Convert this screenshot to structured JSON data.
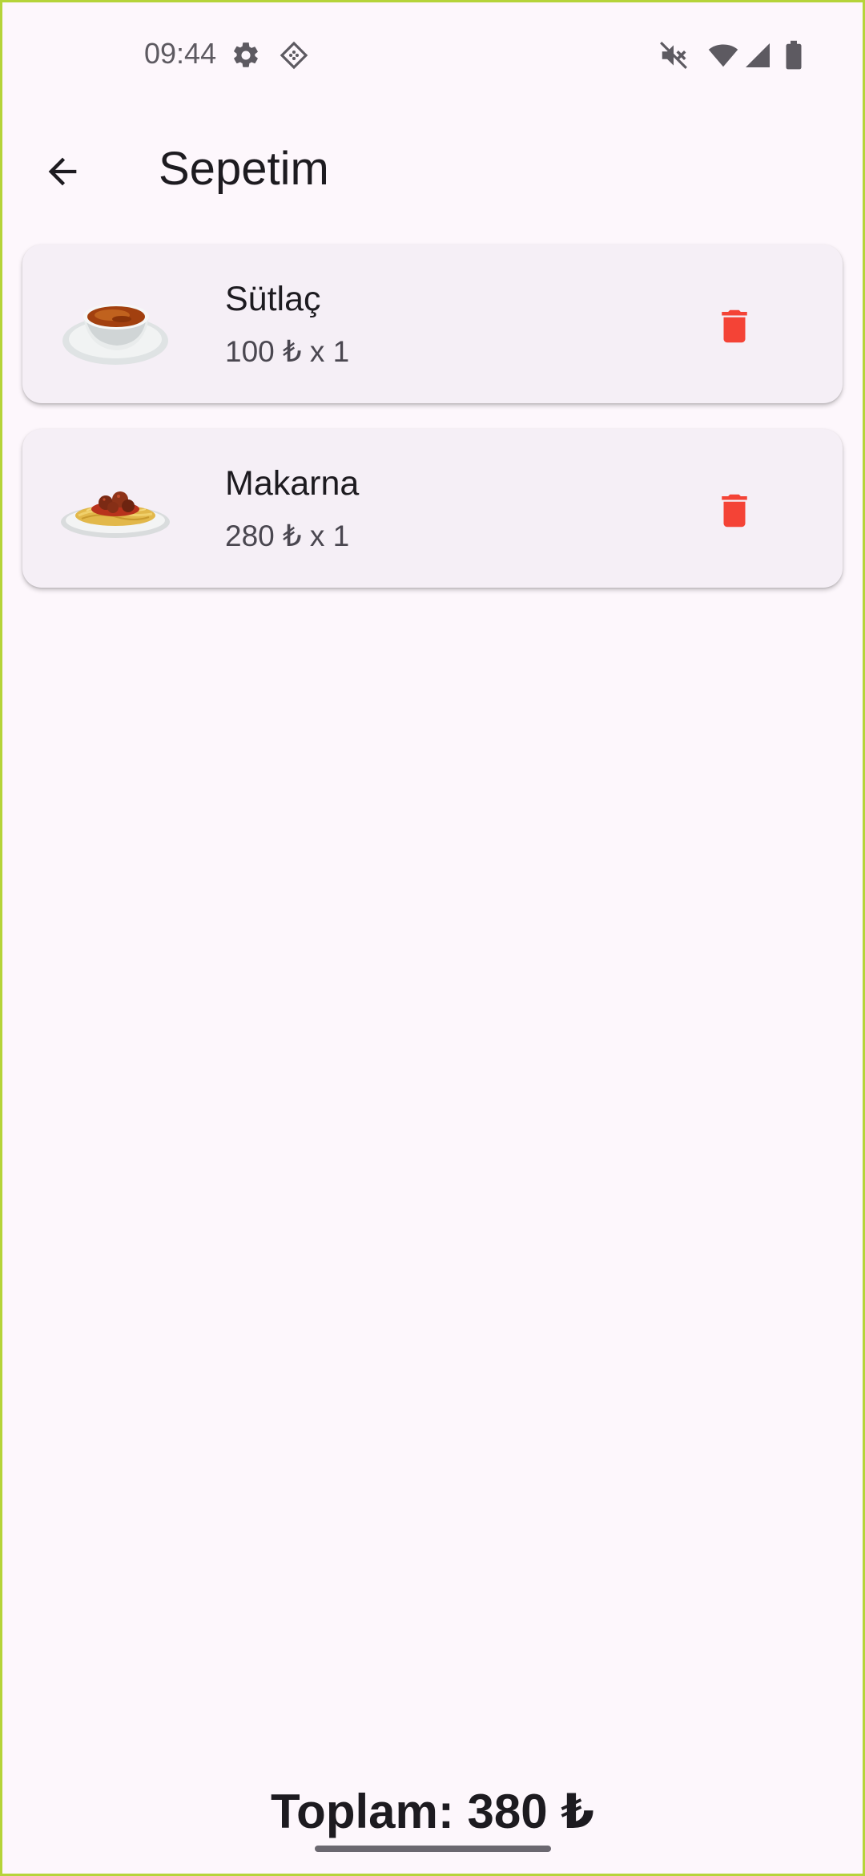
{
  "status_bar": {
    "time": "09:44",
    "icons": [
      "gear-icon",
      "app-diamond-icon",
      "mute-icon",
      "wifi-icon",
      "signal-icon",
      "battery-icon"
    ]
  },
  "app_bar": {
    "title": "Sepetim",
    "back_icon": "arrow-back-icon"
  },
  "cart": {
    "items": [
      {
        "name": "Sütlaç",
        "price_qty": "100 ₺ x 1",
        "image_icon": "soup-bowl-image",
        "delete_icon": "trash-icon"
      },
      {
        "name": "Makarna",
        "price_qty": "280 ₺ x 1",
        "image_icon": "spaghetti-plate-image",
        "delete_icon": "trash-icon"
      }
    ]
  },
  "footer": {
    "total": "Toplam: 380 ₺"
  },
  "colors": {
    "background": "#fdf7fc",
    "card": "#f5eff6",
    "delete": "#f44336",
    "text": "#1d1b20"
  }
}
